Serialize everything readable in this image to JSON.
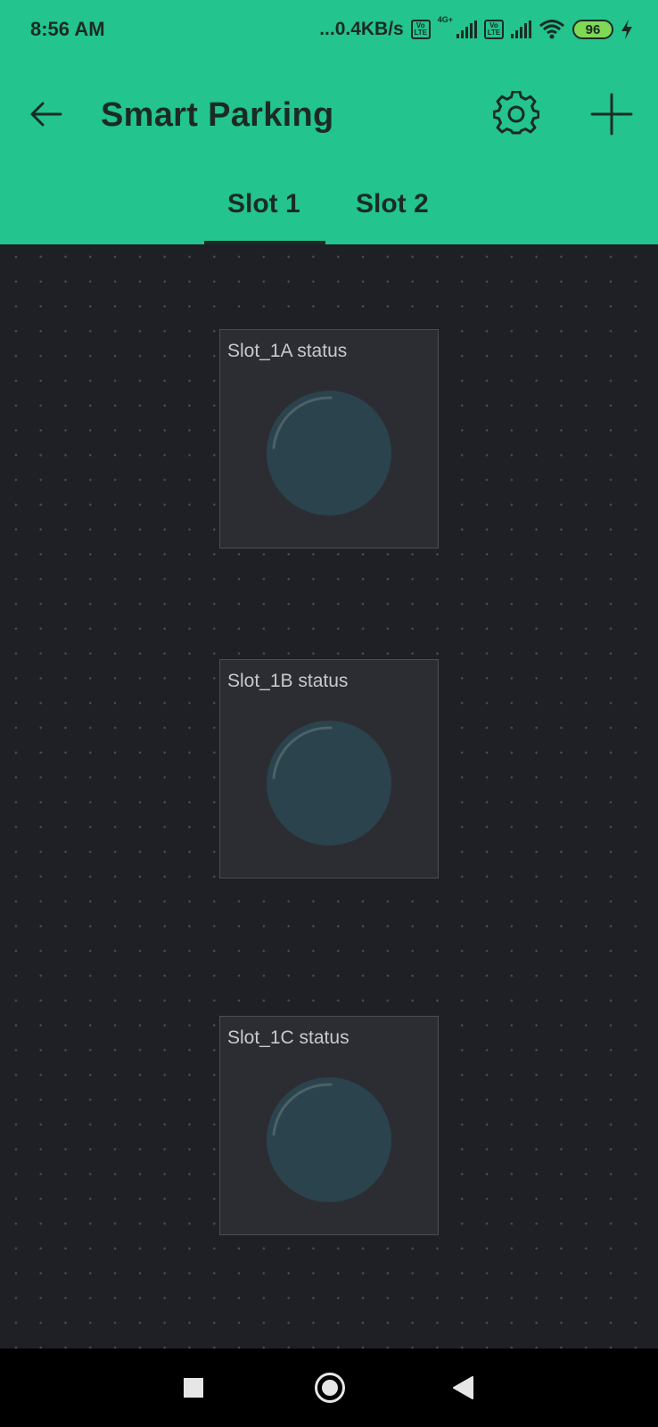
{
  "status_bar": {
    "time": "8:56 AM",
    "net_speed": "...0.4KB/s",
    "volte_1": "Vo LTE",
    "network_type": "4G+",
    "volte_2": "Vo LTE",
    "battery": "96",
    "charging_icon": "lightning-icon"
  },
  "toolbar": {
    "back_icon": "arrow-left-icon",
    "title": "Smart Parking",
    "settings_icon": "gear-icon",
    "add_icon": "plus-icon"
  },
  "tabs": [
    {
      "label": "Slot 1",
      "active": true
    },
    {
      "label": "Slot 2",
      "active": false
    }
  ],
  "widgets": [
    {
      "label": "Slot_1A status",
      "state": "off"
    },
    {
      "label": "Slot_1B status",
      "state": "off"
    },
    {
      "label": "Slot_1C status",
      "state": "off"
    }
  ],
  "colors": {
    "accent": "#23c48e",
    "canvas": "#1f2025",
    "widget_bg": "#2c2d32",
    "led_off": "#2b434d"
  },
  "navbar": {
    "recent_icon": "square-icon",
    "home_icon": "circle-icon",
    "back_icon": "triangle-back-icon"
  }
}
